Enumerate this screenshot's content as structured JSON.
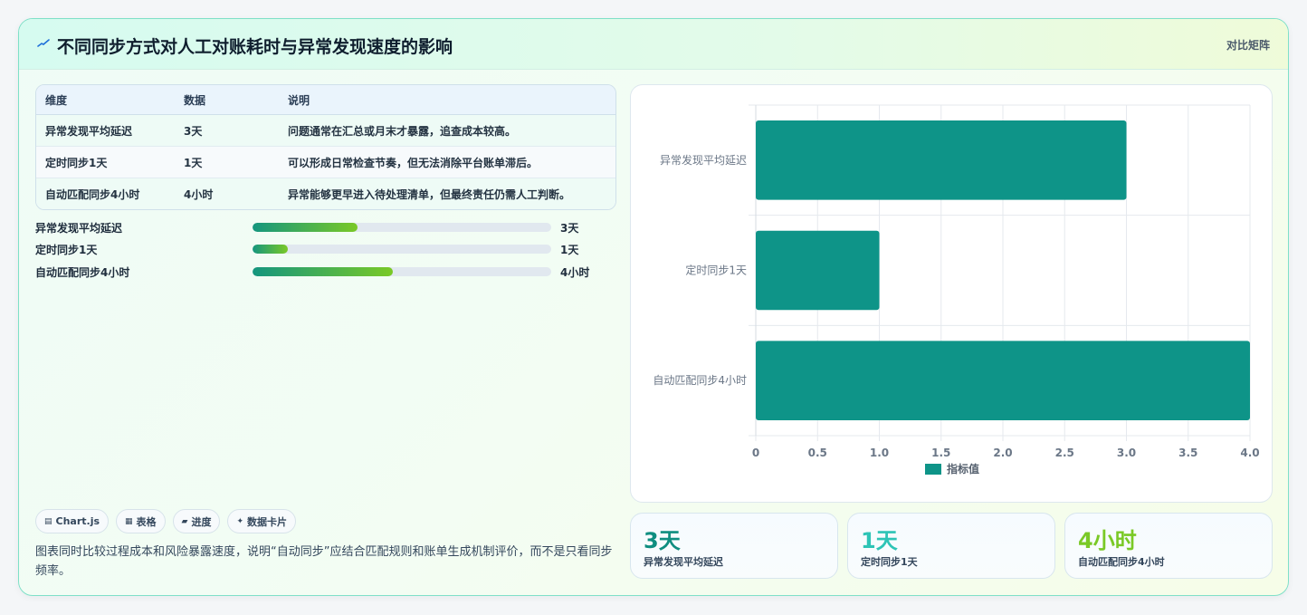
{
  "header": {
    "title": "不同同步方式对人工对账耗时与异常发现速度的影响",
    "tag": "对比矩阵",
    "logo_icon": "trend-line-icon"
  },
  "table": {
    "columns": [
      "维度",
      "数据",
      "说明"
    ],
    "rows": [
      [
        "异常发现平均延迟",
        "3天",
        "问题通常在汇总或月末才暴露，追查成本较高。"
      ],
      [
        "定时同步1天",
        "1天",
        "可以形成日常检查节奏，但无法消除平台账单滞后。"
      ],
      [
        "自动匹配同步4小时",
        "4小时",
        "异常能够更早进入待处理清单，但最终责任仍需人工判断。"
      ]
    ]
  },
  "progress": [
    {
      "label": "异常发现平均延迟",
      "value_text": "3天",
      "fraction": 0.353
    },
    {
      "label": "定时同步1天",
      "value_text": "1天",
      "fraction": 0.118
    },
    {
      "label": "自动匹配同步4小时",
      "value_text": "4小时",
      "fraction": 0.471
    }
  ],
  "chips": [
    {
      "icon": "chart-icon",
      "glyph": "▤",
      "label": "Chart.js"
    },
    {
      "icon": "table-icon",
      "glyph": "▦",
      "label": "表格"
    },
    {
      "icon": "progress-icon",
      "glyph": "▰",
      "label": "进度"
    },
    {
      "icon": "sparkle-icon",
      "glyph": "✦",
      "label": "数据卡片"
    }
  ],
  "note": "图表同时比较过程成本和风险暴露速度，说明“自动同步”应结合匹配规则和账单生成机制评价，而不是只看同步频率。",
  "stats": [
    {
      "value": "3天",
      "label": "异常发现平均延迟",
      "color": "#0f8e80"
    },
    {
      "value": "1天",
      "label": "定时同步1天",
      "color": "#2ec4b6"
    },
    {
      "value": "4小时",
      "label": "自动匹配同步4小时",
      "color": "#7ac926"
    }
  ],
  "chart_data": {
    "type": "bar",
    "orientation": "horizontal",
    "categories": [
      "异常发现平均延迟",
      "定时同步1天",
      "自动匹配同步4小时"
    ],
    "series": [
      {
        "name": "指标值",
        "values": [
          3,
          1,
          4
        ]
      }
    ],
    "xlim": [
      0,
      4
    ],
    "x_ticks": [
      "0",
      "0.5",
      "1.0",
      "1.5",
      "2.0",
      "2.5",
      "3.0",
      "3.5",
      "4.0"
    ],
    "grid": true,
    "legend_position": "bottom",
    "bar_color": "#0e9488"
  }
}
